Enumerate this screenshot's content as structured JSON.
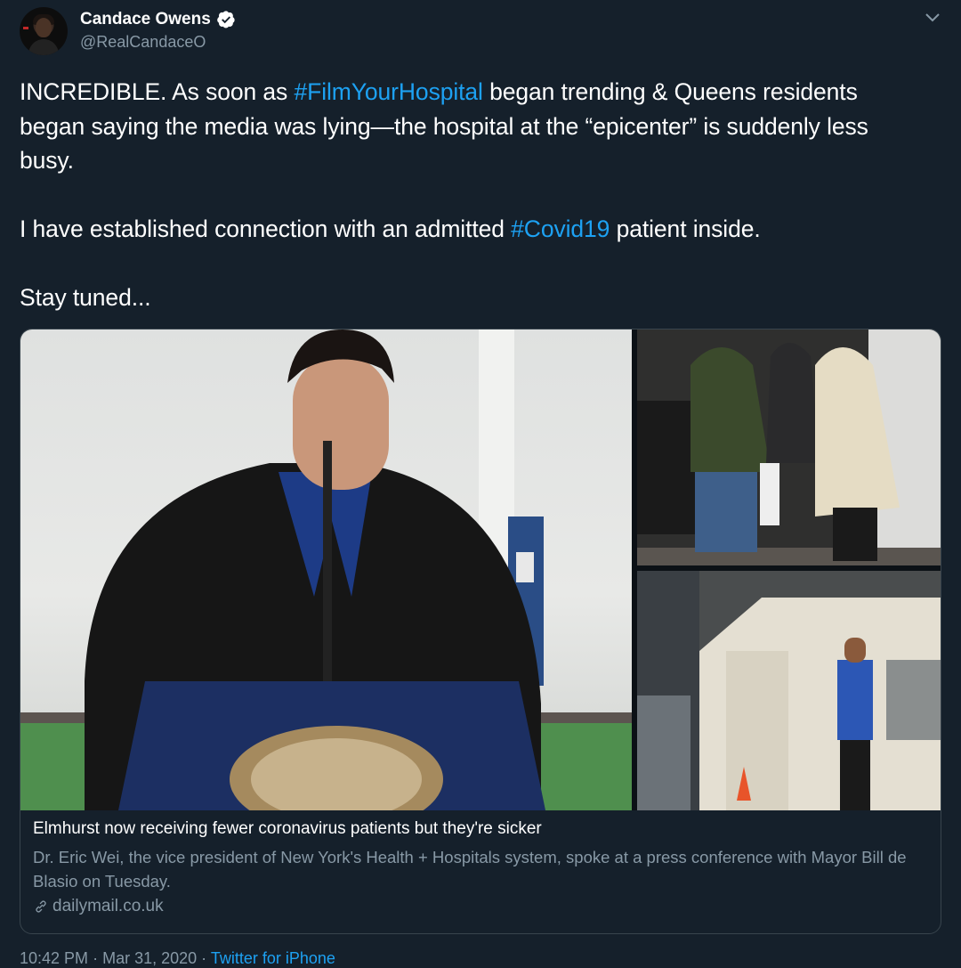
{
  "author": {
    "display_name": "Candace Owens",
    "handle": "@RealCandaceO",
    "verified": true
  },
  "tweet": {
    "line1_pre": "INCREDIBLE. As soon as ",
    "hashtag1": "#FilmYourHospital",
    "line1_post": " began trending & Queens residents began saying the media was lying—the hospital at the “epicenter” is suddenly less busy.",
    "line2_pre": "I have established connection with an admitted ",
    "hashtag2": "#Covid19",
    "line2_post": " patient inside.",
    "line3": "Stay tuned..."
  },
  "link_card": {
    "title": "Elmhurst now receiving fewer coronavirus patients but they're sicker",
    "description": "Dr. Eric Wei, the vice president of New York's Health + Hospitals system, spoke at a press conference with Mayor Bill de Blasio on Tuesday.",
    "domain": "dailymail.co.uk"
  },
  "meta": {
    "time": "10:42 PM",
    "date": "Mar 31, 2020",
    "separator": "·",
    "source": "Twitter for iPhone"
  },
  "icons": {
    "verified": "verified-badge-icon",
    "menu": "chevron-down-icon",
    "link": "link-icon"
  },
  "colors": {
    "background": "#15202b",
    "link": "#1da1f2",
    "secondary_text": "#8899a6",
    "border": "#38444d"
  }
}
